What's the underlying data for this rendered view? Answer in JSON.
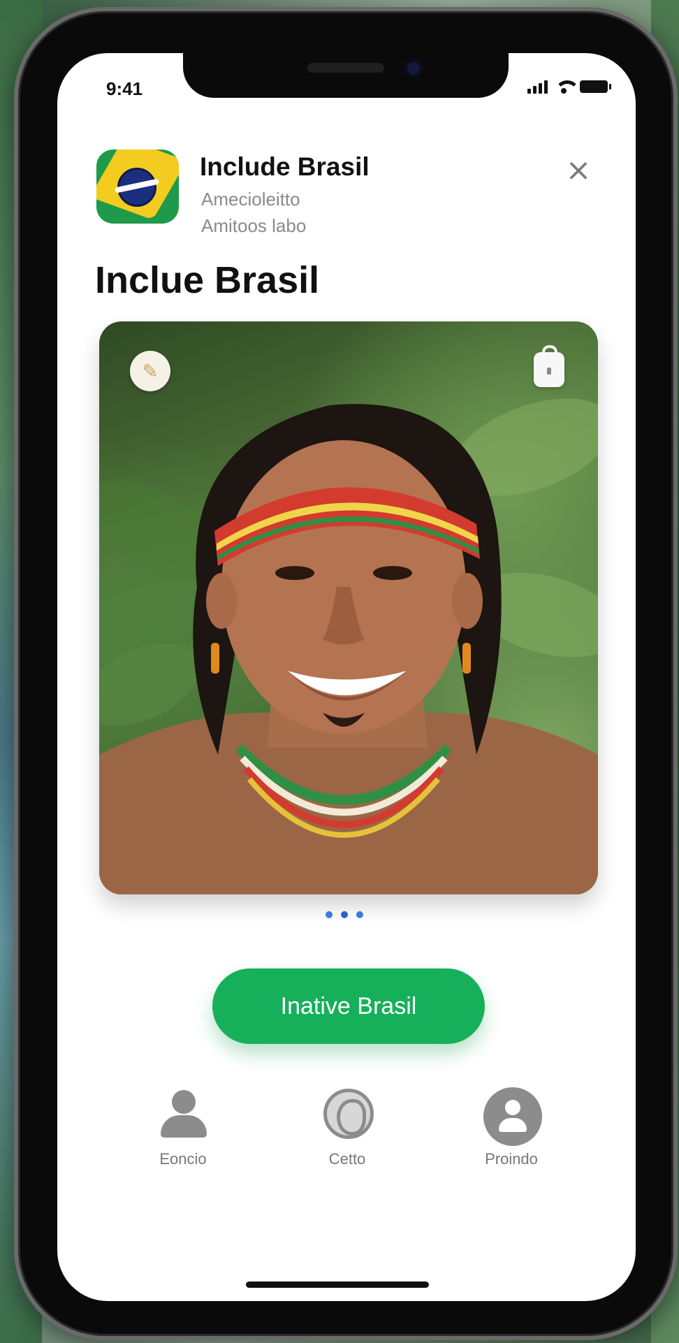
{
  "status_bar": {
    "time": "9:41"
  },
  "app_header": {
    "title": "Include Brasil",
    "subtitle_line1": "Amecioleitto",
    "subtitle_line2": "Amitoos labo",
    "close_glyph": "×"
  },
  "page_title": "Inclue Brasil",
  "carousel": {
    "pages": 3,
    "active_index": 1
  },
  "cta": {
    "label": "Inative Brasil",
    "color": "#16b05a"
  },
  "tabs": [
    {
      "label": "Eoncio",
      "icon": "person-icon"
    },
    {
      "label": "Cetto",
      "icon": "globe-icon"
    },
    {
      "label": "Proindo",
      "icon": "profile-icon"
    }
  ],
  "colors": {
    "brand_green": "#16b05a",
    "flag_yellow": "#f3cc1f",
    "flag_blue": "#1b2f7e",
    "dot_blue": "#3f78e0"
  }
}
